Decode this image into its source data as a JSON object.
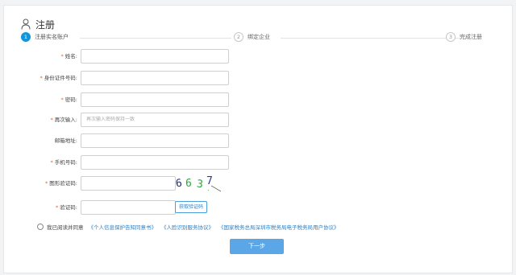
{
  "page_title": "注册",
  "steps": [
    {
      "num": "1",
      "label": "注册实名账户",
      "active": true
    },
    {
      "num": "2",
      "label": "绑定企业",
      "active": false
    },
    {
      "num": "3",
      "label": "完成注册",
      "active": false
    }
  ],
  "form": {
    "name_label": "姓名:",
    "id_label": "身份证件号码:",
    "password_label": "密码:",
    "confirm_label": "再次输入:",
    "confirm_placeholder": "再次输入密码保持一致",
    "email_label": "邮箱地址:",
    "phone_label": "手机号码:",
    "captcha_label": "图形验证码:",
    "captcha_text": [
      "6",
      "6",
      "3",
      "7"
    ],
    "sms_label": "验证码:",
    "sms_button": "获取验证码"
  },
  "agreement": {
    "prefix": "我已阅读并同意",
    "link1": "《个人信息保护告知同意书》",
    "link2": "《人脸识别服务协议》",
    "link3": "《国家税务总局深圳市税务局电子税务局用户协议》"
  },
  "next_button": "下一步",
  "colors": {
    "accent": "#1296db",
    "button": "#5aa6e6",
    "required": "#e6612a",
    "link": "#2d7fc0"
  }
}
